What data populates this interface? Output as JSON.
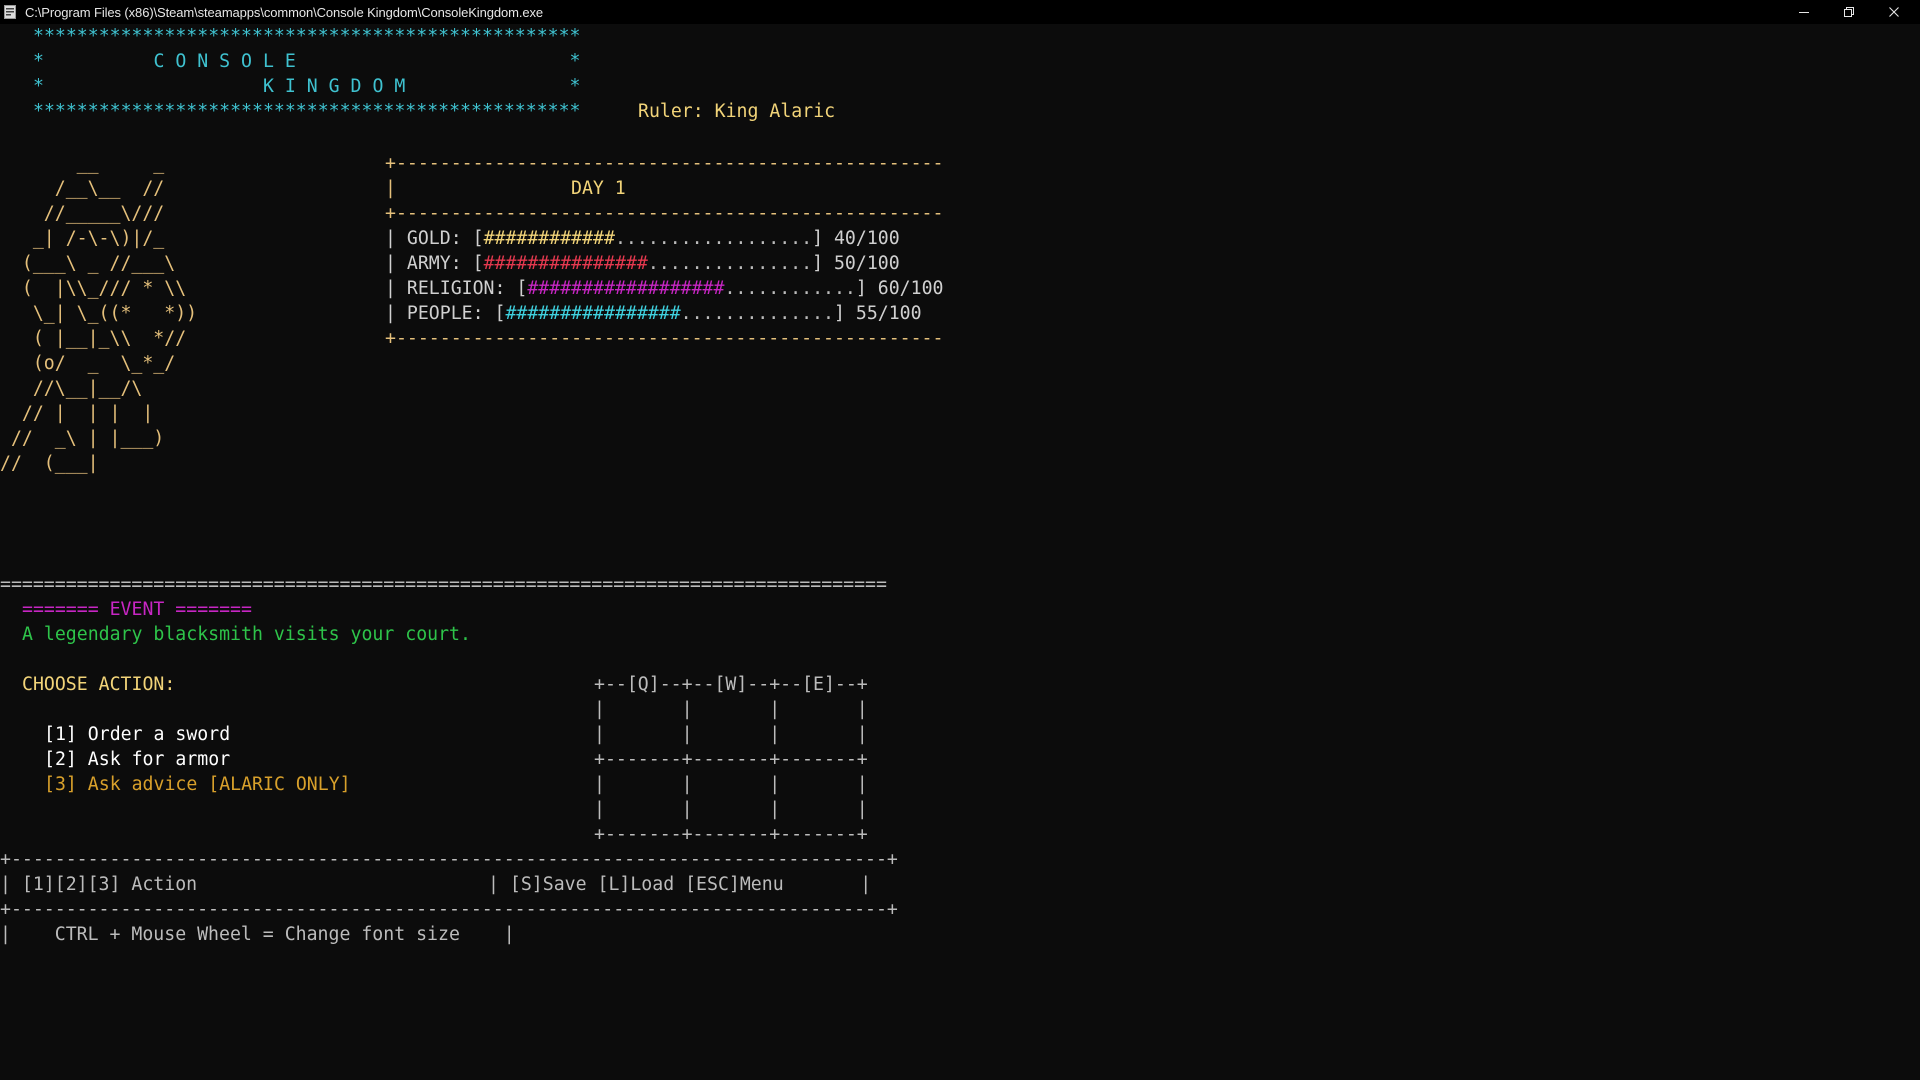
{
  "window": {
    "title": "C:\\Program Files (x86)\\Steam\\steamapps\\common\\Console Kingdom\\ConsoleKingdom.exe",
    "icon": "console-app-icon",
    "controls": {
      "minimize_icon": "minimize-icon",
      "maximize_icon": "restore-icon",
      "close_icon": "close-icon"
    }
  },
  "header": {
    "border_top": "**************************************************",
    "line1": "*          C O N S O L E                         *",
    "line2": "*                    K I N G D O M               *",
    "border_bottom": "**************************************************",
    "ruler_label": "Ruler: King Alaric"
  },
  "art": {
    "lines": [
      "       __     _",
      "     /__\\__  //",
      "    //_____\\///",
      "   _| /-\\-\\)|/_",
      "  (___\\ _ //___\\",
      "  (  |\\\\_/// * \\\\",
      "   \\_| \\_((*   *))",
      "   ( |__|_\\\\  *//",
      "   (o/  _  \\_*_/",
      "   //\\__|__/\\",
      "  // |  | |  |",
      " //  _\\ | |___)",
      "//  (___|"
    ]
  },
  "stats": {
    "border": "+--------------------------------------------------",
    "day_prefix": "|",
    "day_label": "DAY 1",
    "rows": [
      {
        "label": "| GOLD: [",
        "filled": "############",
        "empty": "..................",
        "close": "] ",
        "value": "40/100",
        "fraction": 0.4
      },
      {
        "label": "| ARMY: [",
        "filled": "###############",
        "empty": "...............",
        "close": "] ",
        "value": "50/100",
        "fraction": 0.5
      },
      {
        "label": "| RELIGION: [",
        "filled": "##################",
        "empty": "............",
        "close": "] ",
        "value": "60/100",
        "fraction": 0.6
      },
      {
        "label": "| PEOPLE: [",
        "filled": "################",
        "empty": "..............",
        "close": "] ",
        "value": "55/100",
        "fraction": 0.55
      }
    ]
  },
  "event": {
    "separator": "=================================================================================",
    "header": "======= EVENT =======",
    "description": "A legendary blacksmith visits your court."
  },
  "actions": {
    "prompt": "CHOOSE ACTION:",
    "options": [
      {
        "key": "[1]",
        "text": " Order a sword"
      },
      {
        "key": "[2]",
        "text": " Ask for armor"
      },
      {
        "key": "[3]",
        "text": " Ask advice [ALARIC ONLY]"
      }
    ]
  },
  "keypad": {
    "top": "+--[Q]--+--[W]--+--[E]--+",
    "row": "|       |       |       |",
    "mid": "+-------+-------+-------+",
    "bottom": "+-------+-------+-------+"
  },
  "footer": {
    "border": "+--------------------------------------------------------------------------------+",
    "actions_cell": "| [1][2][3] Action",
    "menu_cell": "| [S]Save [L]Load [ESC]Menu       |",
    "hint": "|    CTRL + Mouse Wheel = Change font size    |"
  },
  "colors": {
    "background": "#0c0c0c",
    "titlebar": "#000000",
    "gold": "#e5c07b",
    "gold_bar": "#f2d479",
    "army_bar": "#e5394f",
    "religion_bar": "#c826c4",
    "people_bar": "#3fd1df",
    "event": "#c826c4",
    "event_text": "#2ec44a",
    "special_option": "#d8a02b"
  }
}
